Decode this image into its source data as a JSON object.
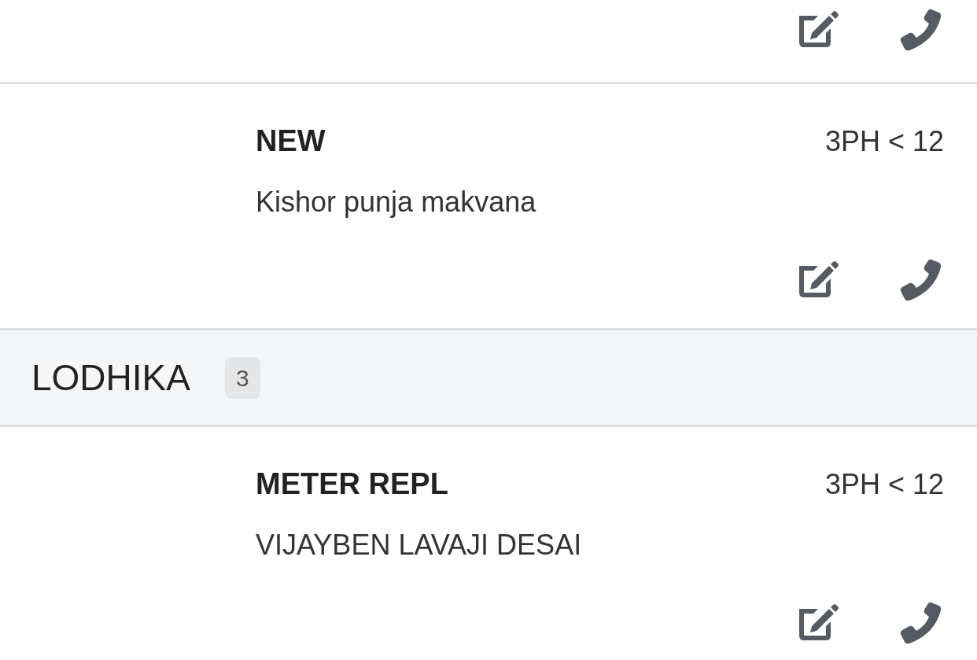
{
  "entries": [
    {
      "kind": "item-tail"
    },
    {
      "kind": "item",
      "title": "NEW",
      "tag": "3PH < 12",
      "name": "Kishor punja makvana"
    },
    {
      "kind": "group",
      "title": "LODHIKA",
      "count": "3"
    },
    {
      "kind": "item",
      "title": "METER REPL",
      "tag": "3PH < 12",
      "name": "VIJAYBEN LAVAJI DESAI"
    }
  ]
}
